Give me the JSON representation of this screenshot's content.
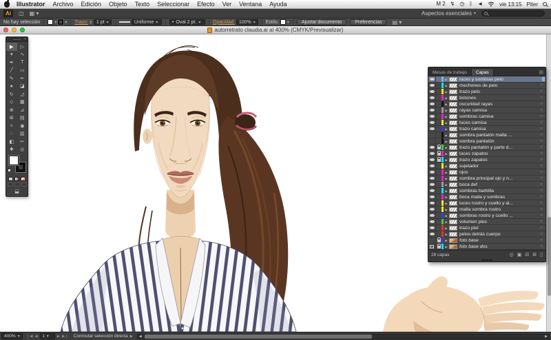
{
  "menu_bar": {
    "items": [
      "Illustrator",
      "Archivo",
      "Edición",
      "Objeto",
      "Texto",
      "Seleccionar",
      "Efecto",
      "Ver",
      "Ventana",
      "Ayuda"
    ],
    "status_icons": [
      {
        "name": "input-source-indicator",
        "glyph": "M 2"
      },
      {
        "name": "sync-icon",
        "glyph": "↯"
      },
      {
        "name": "time-machine-icon",
        "glyph": "◷"
      },
      {
        "name": "bluetooth-icon",
        "glyph": "ᛒ"
      },
      {
        "name": "volume-icon",
        "glyph": "◄"
      }
    ],
    "clock": "vie 13:15",
    "user": "Piter"
  },
  "app_bar": {
    "logo": "Ai",
    "workspace": "Aspectos esenciales"
  },
  "control_bar": {
    "selection_status": "No hay selección",
    "stroke_label": "Trazo:",
    "stroke_width": "1 pt",
    "stroke_profile": "Uniforme",
    "brush": "Oval 2 pt.",
    "opacity_label": "Opacidad:",
    "opacity_value": "100%",
    "style_label": "Estilo:",
    "fit_button": "Ajustar documento",
    "prefs_button": "Preferencias"
  },
  "document": {
    "title": "autorretrato claudia.ai al 400% (CMYK/Previsualizar)"
  },
  "tools": [
    {
      "name": "selection-tool",
      "glyph": "▶",
      "selected": true
    },
    {
      "name": "direct-selection-tool",
      "glyph": "▷"
    },
    {
      "name": "magic-wand-tool",
      "glyph": "✦"
    },
    {
      "name": "lasso-tool",
      "glyph": "∿"
    },
    {
      "name": "pen-tool",
      "glyph": "✒"
    },
    {
      "name": "type-tool",
      "glyph": "T"
    },
    {
      "name": "line-segment-tool",
      "glyph": "╱"
    },
    {
      "name": "rectangle-tool",
      "glyph": "▭"
    },
    {
      "name": "paintbrush-tool",
      "glyph": "✎"
    },
    {
      "name": "pencil-tool",
      "glyph": "✏"
    },
    {
      "name": "blob-brush-tool",
      "glyph": "●"
    },
    {
      "name": "eraser-tool",
      "glyph": "◪"
    },
    {
      "name": "rotate-tool",
      "glyph": "↻"
    },
    {
      "name": "scale-tool",
      "glyph": "◿"
    },
    {
      "name": "width-tool",
      "glyph": "◇"
    },
    {
      "name": "free-transform-tool",
      "glyph": "▦"
    },
    {
      "name": "shape-builder-tool",
      "glyph": "⊕"
    },
    {
      "name": "perspective-grid-tool",
      "glyph": "⊿"
    },
    {
      "name": "mesh-tool",
      "glyph": "⊞"
    },
    {
      "name": "gradient-tool",
      "glyph": "▤"
    },
    {
      "name": "eyedropper-tool",
      "glyph": "✧"
    },
    {
      "name": "blend-tool",
      "glyph": "◉"
    },
    {
      "name": "symbol-sprayer-tool",
      "glyph": "∴"
    },
    {
      "name": "column-graph-tool",
      "glyph": "▥"
    },
    {
      "name": "artboard-tool",
      "glyph": "◧"
    },
    {
      "name": "slice-tool",
      "glyph": "✂"
    },
    {
      "name": "hand-tool",
      "glyph": "✚"
    },
    {
      "name": "zoom-tool",
      "glyph": "◎"
    }
  ],
  "layers_panel": {
    "tab_artboards": "Mesas de trabajo",
    "tab_layers": "Capas",
    "panel_menu_icon": "▤",
    "count_label": "28 capas",
    "footer_icons": [
      {
        "name": "locate-object-icon",
        "glyph": "◎"
      },
      {
        "name": "clipping-mask-icon",
        "glyph": "▣"
      },
      {
        "name": "new-sublayer-icon",
        "glyph": "⊟"
      },
      {
        "name": "new-layer-icon",
        "glyph": "⊞"
      },
      {
        "name": "delete-layer-icon",
        "glyph": "▯"
      }
    ],
    "layers": [
      {
        "name": "luces y sombras pelo",
        "color": "#7fb2e5",
        "eye": true,
        "lock": false,
        "selected": true
      },
      {
        "name": "mechones de pelo",
        "color": "#00e4f0",
        "eye": true,
        "lock": false
      },
      {
        "name": "trazo pelo",
        "color": "#efe52a",
        "eye": true,
        "lock": false
      },
      {
        "name": "botones",
        "color": "#ed1ec6",
        "eye": true,
        "lock": false
      },
      {
        "name": "oscuridad rayas",
        "color": "#111111",
        "eye": true,
        "lock": false
      },
      {
        "name": "rayas camisa",
        "color": "#9a9a9a",
        "eye": true,
        "lock": false
      },
      {
        "name": "sombras camisa",
        "color": "#ed1ec6",
        "eye": true,
        "lock": false
      },
      {
        "name": "luces camisa",
        "color": "#efe52a",
        "eye": true,
        "lock": false
      },
      {
        "name": "trazo camisa",
        "color": "#3a3ae8",
        "eye": true,
        "lock": false
      },
      {
        "name": "sombra pantalón malla ...",
        "color": "#111111",
        "eye": false,
        "lock": false
      },
      {
        "name": "sombra pantalón",
        "color": "#111111",
        "eye": false,
        "lock": false
      },
      {
        "name": "trazo pantalón y parte d...",
        "color": "#35d13c",
        "eye": true,
        "lock": true
      },
      {
        "name": "luces zapatos",
        "color": "#ed1ec6",
        "eye": true,
        "lock": true
      },
      {
        "name": "trazo zapatos",
        "color": "#00e4f0",
        "eye": true,
        "lock": true
      },
      {
        "name": "sujetador",
        "color": "#efe52a",
        "eye": true,
        "lock": false
      },
      {
        "name": "ojos",
        "color": "#ed1ec6",
        "eye": true,
        "lock": false
      },
      {
        "name": "sombra principal ojo y n...",
        "color": "#ed1ec6",
        "eye": true,
        "lock": false
      },
      {
        "name": "boca def",
        "color": "#9a9a9a",
        "eye": true,
        "lock": false
      },
      {
        "name": "sombras barbilla",
        "color": "#00e4f0",
        "eye": true,
        "lock": false
      },
      {
        "name": "boca malla y sombras",
        "color": "#ed1ec6",
        "eye": true,
        "lock": false
      },
      {
        "name": "luces rostro y cuello y al...",
        "color": "#efe52a",
        "eye": true,
        "lock": false
      },
      {
        "name": "malla sombra rostro",
        "color": "#efe52a",
        "eye": true,
        "lock": false
      },
      {
        "name": "sombras rostro y cuello ...",
        "color": "#3a3ae8",
        "eye": true,
        "lock": false
      },
      {
        "name": "volumen pies",
        "color": "#35d13c",
        "eye": true,
        "lock": false
      },
      {
        "name": "trazo piel",
        "color": "#e8342a",
        "eye": true,
        "lock": false
      },
      {
        "name": "pelos detrás cuerpo",
        "color": "#e8342a",
        "eye": true,
        "lock": false
      },
      {
        "name": "foto base",
        "color": "#3a3ae8",
        "eye": false,
        "lock": true,
        "italic": true,
        "thumb": "photo"
      },
      {
        "name": "foto base dos",
        "color": "#00e4f0",
        "eye": "template",
        "lock": true,
        "italic": true,
        "thumb": "photo"
      }
    ]
  },
  "status_bar": {
    "zoom": "400%",
    "artboard": "1",
    "tool_hint": "Conmutar selección directa"
  }
}
